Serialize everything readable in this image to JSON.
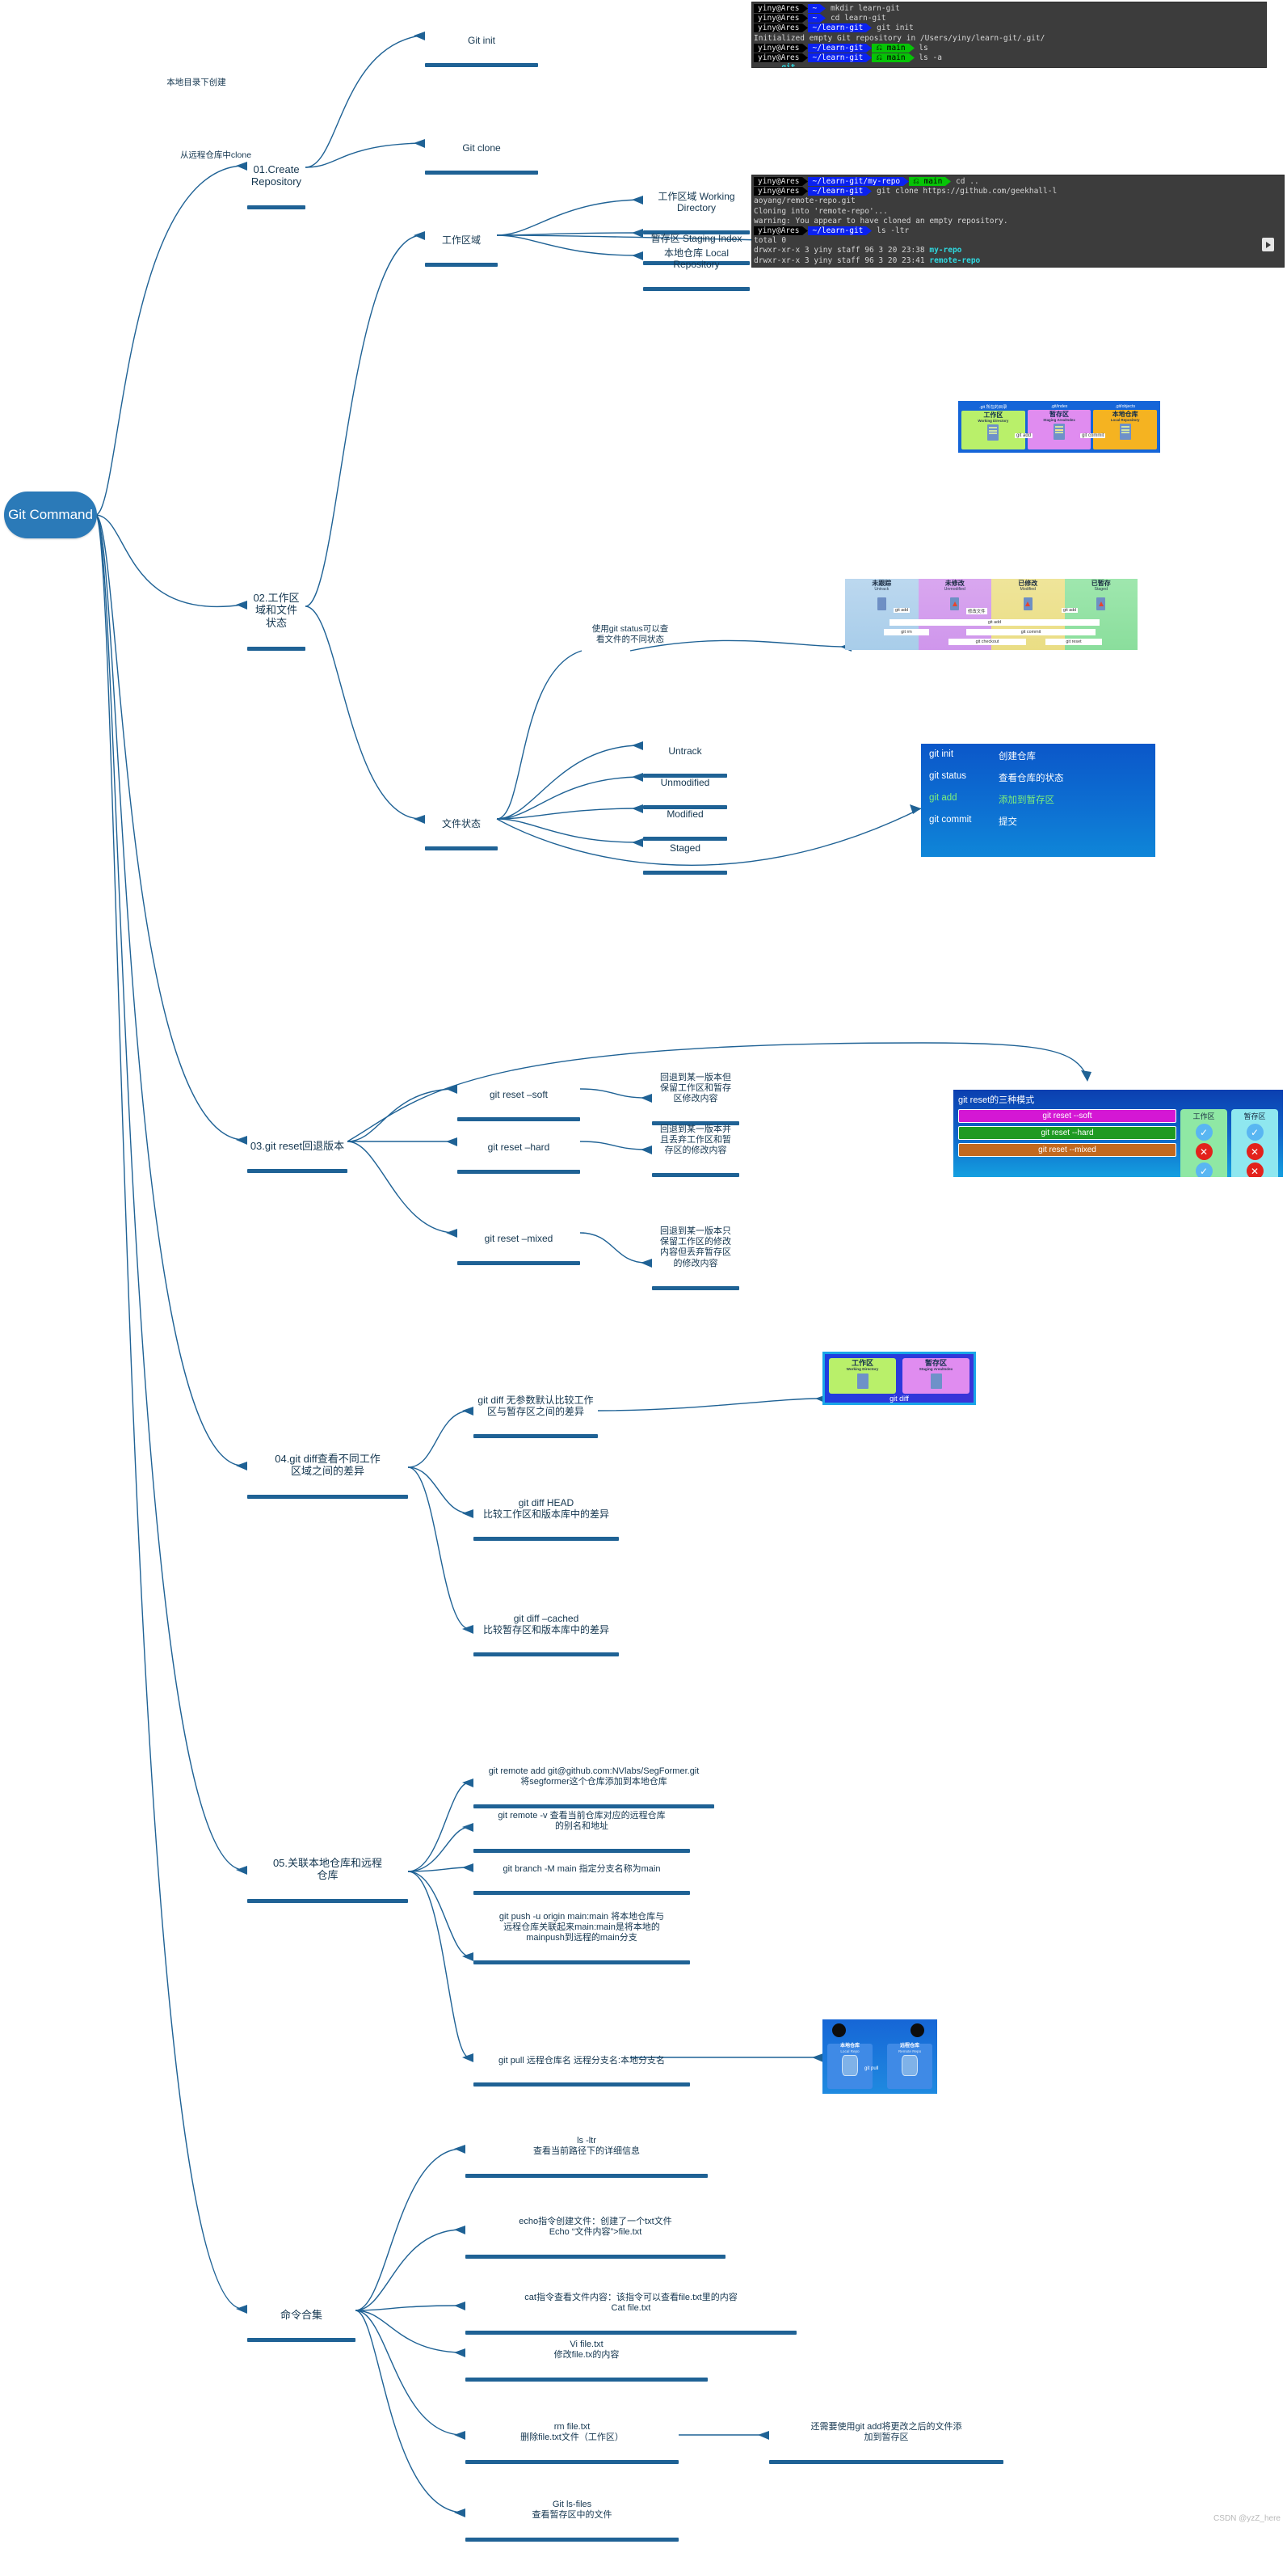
{
  "root": {
    "label": "Git Command"
  },
  "branches": {
    "b01": {
      "label": "01.Create Repository"
    },
    "b02": {
      "label": "02.工作区域和文件\n状态"
    },
    "b03": {
      "label": "03.git reset回退版本"
    },
    "b04": {
      "label": "04.git diff查看不同工作\n区域之间的差异"
    },
    "b05": {
      "label": "05.关联本地仓库和远程\n仓库"
    },
    "b06": {
      "label": "命令合集"
    }
  },
  "nodes": {
    "git_init": "Git init",
    "git_clone": "Git clone",
    "work_area": "工作区域",
    "file_state": "文件状态",
    "working_directory": "工作区域 Working\nDirectory",
    "staging_index": "暂存区 Staging Index",
    "local_repository": "本地仓库 Local\nRepository",
    "untrack": "Untrack",
    "unmodified": "Unmodified",
    "modified": "Modified",
    "staged": "Staged",
    "reset_soft": "git reset –soft",
    "reset_hard": "git reset –hard",
    "reset_mixed": "git reset –mixed",
    "reset_soft_desc": "回退到某一版本但\n保留工作区和暂存\n区修改内容",
    "reset_hard_desc": "回退到某一版本并\n且丢弃工作区和暂\n存区的修改内容",
    "reset_mixed_desc": "回退到某一版本只\n保留工作区的修改\n内容但丢弃暂存区\n的修改内容",
    "diff_default": "git diff 无参数默认比较工作\n区与暂存区之间的差异",
    "diff_head": "git diff HEAD\n比较工作区和版本库中的差异",
    "diff_cached": "git diff –cached\n比较暂存区和版本库中的差异",
    "remote_add": "git remote add git@github.com:NVlabs/SegFormer.git\n将segformer这个仓库添加到本地仓库",
    "remote_v": "git remote -v 查看当前仓库对应的远程仓库\n的别名和地址",
    "branch_m": "git branch -M main 指定分支名称为main",
    "push_u": "git push -u origin main:main  将本地仓库与\n远程仓库关联起来main:main是将本地的\nmainpush到远程的main分支",
    "git_pull": "git pull 远程仓库名 远程分支名:本地分支名",
    "ls_ltr": "ls -ltr\n查看当前路径下的详细信息",
    "echo_cmd": "echo指令创建文件：创建了一个txt文件\nEcho “文件内容”>file.txt",
    "cat_cmd": "cat指令查看文件内容：该指令可以查看file.txt里的内容\nCat file.txt",
    "vi_cmd": "Vi file.txt\n修改file.tx的内容",
    "rm_cmd": "rm file.txt\n删除file.txt文件（工作区）",
    "rm_note": "还需要使用git add将更改之后的文件添\n加到暂存区",
    "ls_files": "Git ls-files\n查看暂存区中的文件"
  },
  "annotations": {
    "local_create": "本地目录下创建",
    "clone_from_remote": "从远程仓库中clone",
    "git_status_note": "使用git status可以查\n看文件的不同状态"
  },
  "terminal1": {
    "lines": [
      {
        "type": "prompt",
        "user": "yiny@Ares",
        "path": "~",
        "branch": null,
        "cmd": "mkdir learn-git"
      },
      {
        "type": "prompt",
        "user": "yiny@Ares",
        "path": "~",
        "branch": null,
        "cmd": "cd learn-git"
      },
      {
        "type": "prompt",
        "user": "yiny@Ares",
        "path": "~/learn-git",
        "branch": null,
        "cmd": "git init"
      },
      {
        "type": "out",
        "text": "Initialized empty Git repository in /Users/yiny/learn-git/.git/"
      },
      {
        "type": "prompt",
        "user": "yiny@Ares",
        "path": "~/learn-git",
        "branch": "main",
        "cmd": "ls"
      },
      {
        "type": "prompt",
        "user": "yiny@Ares",
        "path": "~/learn-git",
        "branch": "main",
        "cmd": "ls -a"
      },
      {
        "type": "out2",
        "pre": ".   ..   ",
        "hl": ".git"
      },
      {
        "type": "prompt",
        "user": "yiny@Ares",
        "path": "~/learn-git",
        "branch": "main",
        "cmd": "",
        "cursor": true
      }
    ]
  },
  "terminal2": {
    "lines": [
      {
        "type": "prompt",
        "user": "yiny@Ares",
        "path": "~/learn-git/my-repo",
        "branch": "main",
        "cmd": "cd .."
      },
      {
        "type": "prompt",
        "user": "yiny@Ares",
        "path": "~/learn-git",
        "branch": null,
        "cmd": "git clone https://github.com/geekhall-l"
      },
      {
        "type": "out",
        "text": "aoyang/remote-repo.git"
      },
      {
        "type": "out",
        "text": "Cloning into 'remote-repo'..."
      },
      {
        "type": "out",
        "text": "warning: You appear to have cloned an empty repository."
      },
      {
        "type": "prompt",
        "user": "yiny@Ares",
        "path": "~/learn-git",
        "branch": null,
        "cmd": "ls -ltr"
      },
      {
        "type": "out",
        "text": "total 0"
      },
      {
        "type": "out3",
        "pre": "drwxr-xr-x  3 yiny  staff  96  3 20 23:38 ",
        "hl": "my-repo"
      },
      {
        "type": "out3",
        "pre": "drwxr-xr-x  3 yiny  staff  96  3 20 23:41 ",
        "hl": "remote-repo"
      }
    ]
  },
  "pic_areas": {
    "columns": [
      {
        "caption": ".git 所在的目录",
        "title": "工作区",
        "subtitle": "Working Directory"
      },
      {
        "caption": ".git/index",
        "title": "暂存区",
        "subtitle": "Staging Area/Index"
      },
      {
        "caption": ".git/objects",
        "title": "本地仓库",
        "subtitle": "Local Repository"
      }
    ],
    "arrows": [
      "git add",
      "git commit"
    ]
  },
  "pic_states": {
    "columns": [
      {
        "title": "未跟踪",
        "subtitle": "Untrack"
      },
      {
        "title": "未修改",
        "subtitle": "Unmodified"
      },
      {
        "title": "已修改",
        "subtitle": "Modified"
      },
      {
        "title": "已暂存",
        "subtitle": "Staged"
      }
    ],
    "top_arrows": [
      "git add",
      "修改文件",
      "git add"
    ],
    "bands": [
      "git add",
      "git rm",
      "git commit",
      "git checkout",
      "git reset"
    ]
  },
  "pic_cmds": {
    "rows": [
      {
        "cmd": "git init",
        "desc": "创建仓库",
        "color": "#ffffff"
      },
      {
        "cmd": "git status",
        "desc": "查看仓库的状态",
        "color": "#ffffff"
      },
      {
        "cmd": "git add",
        "desc": "添加到暂存区",
        "color": "#7ef07a"
      },
      {
        "cmd": "git commit",
        "desc": "提交",
        "color": "#ffffff"
      }
    ]
  },
  "pic_reset": {
    "title": "git reset的三种模式",
    "modes": [
      "git reset --soft",
      "git reset --hard",
      "git reset --mixed"
    ],
    "columns": [
      "工作区",
      "暂存区"
    ],
    "matrix": [
      [
        "ok",
        "ok"
      ],
      [
        "no",
        "no"
      ],
      [
        "ok",
        "no"
      ]
    ]
  },
  "pic_diff": {
    "boxes": [
      {
        "title": "工作区",
        "subtitle": "Working Directory"
      },
      {
        "title": "暂存区",
        "subtitle": "Staging Area/Index"
      }
    ],
    "caption": "git diff"
  },
  "pic_pull": {
    "left": {
      "title": "本地仓库",
      "subtitle": "Local Repo"
    },
    "right": {
      "title": "远程仓库",
      "subtitle": "Remote Repo"
    },
    "label": "git pull"
  },
  "watermark": "CSDN @yzZ_here"
}
